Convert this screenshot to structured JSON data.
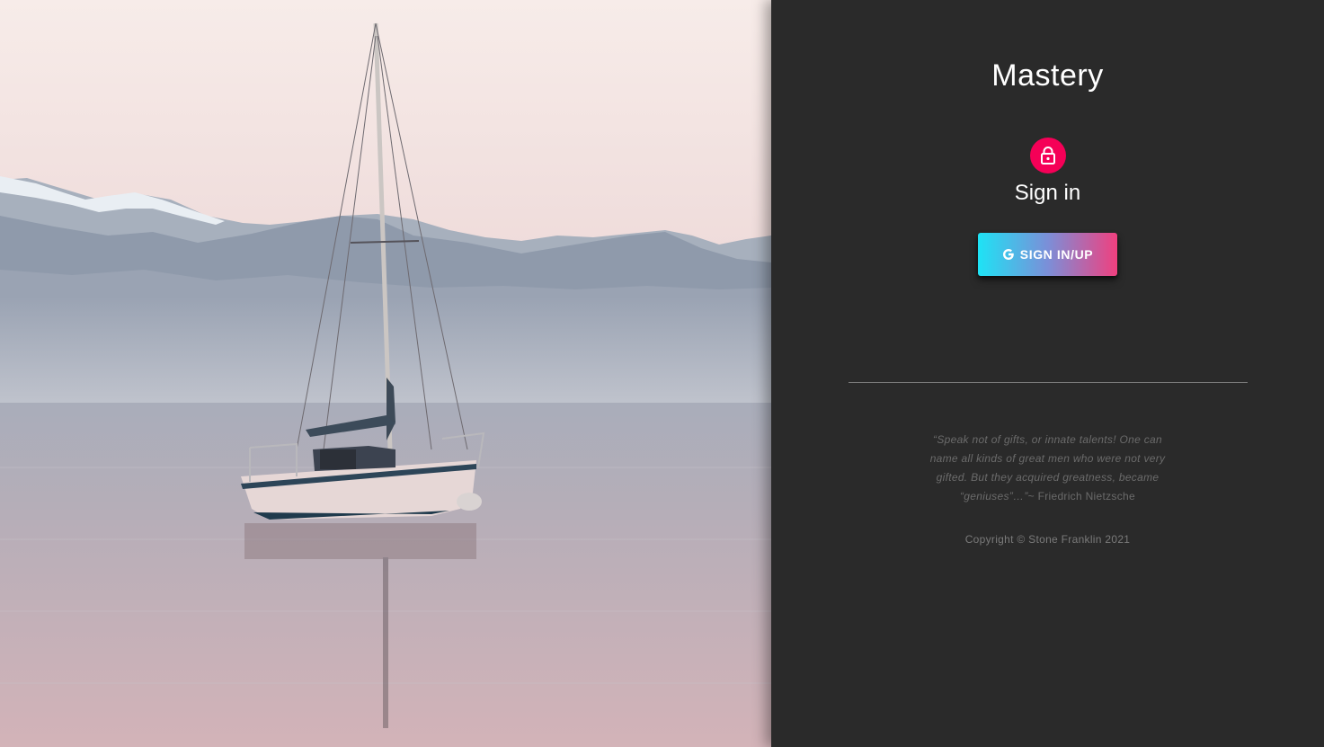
{
  "hero": {
    "image": "sailboat-on-lake-photo"
  },
  "brand": {
    "title": "Mastery"
  },
  "auth": {
    "icon": "lock-icon",
    "heading": "Sign in",
    "button_icon": "google-icon",
    "button_label": "SIGN IN/UP"
  },
  "footer": {
    "quote_text": "“Speak not of gifts, or innate talents! One can name all kinds of great men who were not very gifted. But they acquired greatness, became “geniuses”…”",
    "quote_author": "~ Friedrich Nietzsche",
    "copyright": "Copyright © Stone Franklin 2021"
  },
  "colors": {
    "panel_bg": "#2a2a2a",
    "accent": "#f50057",
    "button_gradient_start": "#1ee3f5",
    "button_gradient_end": "#f0407f"
  }
}
